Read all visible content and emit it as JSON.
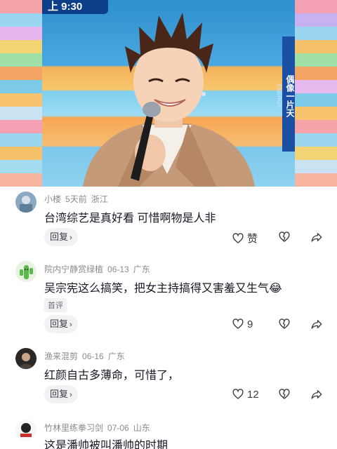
{
  "video": {
    "channel_logo": "上 9:30",
    "side_banner": "偶像一片天",
    "side_banner_sub": "ENERGY"
  },
  "comments": [
    {
      "username": "小楼",
      "time": "5天前",
      "location": "浙江",
      "text": "台湾综艺是真好看  可惜啊物是人非",
      "tag": "",
      "reply_label": "回复",
      "like_label": "赞",
      "like_count": ""
    },
    {
      "username": "院内宁静赏绿植",
      "time": "06-13",
      "location": "广东",
      "text": "吴宗宪这么搞笑，把女主持搞得又害羞又生气😂",
      "tag": "首评",
      "reply_label": "回复",
      "like_label": "",
      "like_count": "9"
    },
    {
      "username": "渔来混剪",
      "time": "06-16",
      "location": "广东",
      "text": "红颜自古多薄命，可惜了，",
      "tag": "",
      "reply_label": "回复",
      "like_label": "",
      "like_count": "12"
    },
    {
      "username": "竹林里练拳习剑",
      "time": "07-06",
      "location": "山东",
      "text": "这是潘帅被叫潘帅的时期",
      "tag": "",
      "reply_label": "",
      "like_label": "",
      "like_count": ""
    }
  ],
  "icons": {
    "heart": "heart-outline-icon",
    "dislike": "broken-heart-icon",
    "share": "share-arrow-icon",
    "reply_chevron": "chevron-right-icon"
  },
  "colors": {
    "text": "#161823",
    "meta": "#8a8b91",
    "button_bg": "#f2f2f4"
  }
}
